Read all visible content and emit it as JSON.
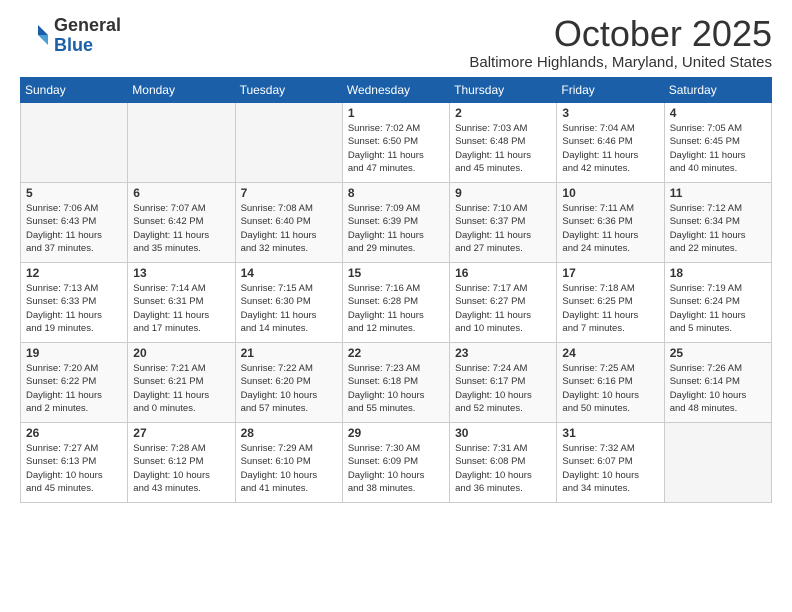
{
  "header": {
    "logo_line1": "General",
    "logo_line2": "Blue",
    "month": "October 2025",
    "location": "Baltimore Highlands, Maryland, United States"
  },
  "weekdays": [
    "Sunday",
    "Monday",
    "Tuesday",
    "Wednesday",
    "Thursday",
    "Friday",
    "Saturday"
  ],
  "weeks": [
    [
      {
        "day": "",
        "info": ""
      },
      {
        "day": "",
        "info": ""
      },
      {
        "day": "",
        "info": ""
      },
      {
        "day": "1",
        "info": "Sunrise: 7:02 AM\nSunset: 6:50 PM\nDaylight: 11 hours\nand 47 minutes."
      },
      {
        "day": "2",
        "info": "Sunrise: 7:03 AM\nSunset: 6:48 PM\nDaylight: 11 hours\nand 45 minutes."
      },
      {
        "day": "3",
        "info": "Sunrise: 7:04 AM\nSunset: 6:46 PM\nDaylight: 11 hours\nand 42 minutes."
      },
      {
        "day": "4",
        "info": "Sunrise: 7:05 AM\nSunset: 6:45 PM\nDaylight: 11 hours\nand 40 minutes."
      }
    ],
    [
      {
        "day": "5",
        "info": "Sunrise: 7:06 AM\nSunset: 6:43 PM\nDaylight: 11 hours\nand 37 minutes."
      },
      {
        "day": "6",
        "info": "Sunrise: 7:07 AM\nSunset: 6:42 PM\nDaylight: 11 hours\nand 35 minutes."
      },
      {
        "day": "7",
        "info": "Sunrise: 7:08 AM\nSunset: 6:40 PM\nDaylight: 11 hours\nand 32 minutes."
      },
      {
        "day": "8",
        "info": "Sunrise: 7:09 AM\nSunset: 6:39 PM\nDaylight: 11 hours\nand 29 minutes."
      },
      {
        "day": "9",
        "info": "Sunrise: 7:10 AM\nSunset: 6:37 PM\nDaylight: 11 hours\nand 27 minutes."
      },
      {
        "day": "10",
        "info": "Sunrise: 7:11 AM\nSunset: 6:36 PM\nDaylight: 11 hours\nand 24 minutes."
      },
      {
        "day": "11",
        "info": "Sunrise: 7:12 AM\nSunset: 6:34 PM\nDaylight: 11 hours\nand 22 minutes."
      }
    ],
    [
      {
        "day": "12",
        "info": "Sunrise: 7:13 AM\nSunset: 6:33 PM\nDaylight: 11 hours\nand 19 minutes."
      },
      {
        "day": "13",
        "info": "Sunrise: 7:14 AM\nSunset: 6:31 PM\nDaylight: 11 hours\nand 17 minutes."
      },
      {
        "day": "14",
        "info": "Sunrise: 7:15 AM\nSunset: 6:30 PM\nDaylight: 11 hours\nand 14 minutes."
      },
      {
        "day": "15",
        "info": "Sunrise: 7:16 AM\nSunset: 6:28 PM\nDaylight: 11 hours\nand 12 minutes."
      },
      {
        "day": "16",
        "info": "Sunrise: 7:17 AM\nSunset: 6:27 PM\nDaylight: 11 hours\nand 10 minutes."
      },
      {
        "day": "17",
        "info": "Sunrise: 7:18 AM\nSunset: 6:25 PM\nDaylight: 11 hours\nand 7 minutes."
      },
      {
        "day": "18",
        "info": "Sunrise: 7:19 AM\nSunset: 6:24 PM\nDaylight: 11 hours\nand 5 minutes."
      }
    ],
    [
      {
        "day": "19",
        "info": "Sunrise: 7:20 AM\nSunset: 6:22 PM\nDaylight: 11 hours\nand 2 minutes."
      },
      {
        "day": "20",
        "info": "Sunrise: 7:21 AM\nSunset: 6:21 PM\nDaylight: 11 hours\nand 0 minutes."
      },
      {
        "day": "21",
        "info": "Sunrise: 7:22 AM\nSunset: 6:20 PM\nDaylight: 10 hours\nand 57 minutes."
      },
      {
        "day": "22",
        "info": "Sunrise: 7:23 AM\nSunset: 6:18 PM\nDaylight: 10 hours\nand 55 minutes."
      },
      {
        "day": "23",
        "info": "Sunrise: 7:24 AM\nSunset: 6:17 PM\nDaylight: 10 hours\nand 52 minutes."
      },
      {
        "day": "24",
        "info": "Sunrise: 7:25 AM\nSunset: 6:16 PM\nDaylight: 10 hours\nand 50 minutes."
      },
      {
        "day": "25",
        "info": "Sunrise: 7:26 AM\nSunset: 6:14 PM\nDaylight: 10 hours\nand 48 minutes."
      }
    ],
    [
      {
        "day": "26",
        "info": "Sunrise: 7:27 AM\nSunset: 6:13 PM\nDaylight: 10 hours\nand 45 minutes."
      },
      {
        "day": "27",
        "info": "Sunrise: 7:28 AM\nSunset: 6:12 PM\nDaylight: 10 hours\nand 43 minutes."
      },
      {
        "day": "28",
        "info": "Sunrise: 7:29 AM\nSunset: 6:10 PM\nDaylight: 10 hours\nand 41 minutes."
      },
      {
        "day": "29",
        "info": "Sunrise: 7:30 AM\nSunset: 6:09 PM\nDaylight: 10 hours\nand 38 minutes."
      },
      {
        "day": "30",
        "info": "Sunrise: 7:31 AM\nSunset: 6:08 PM\nDaylight: 10 hours\nand 36 minutes."
      },
      {
        "day": "31",
        "info": "Sunrise: 7:32 AM\nSunset: 6:07 PM\nDaylight: 10 hours\nand 34 minutes."
      },
      {
        "day": "",
        "info": ""
      }
    ]
  ]
}
